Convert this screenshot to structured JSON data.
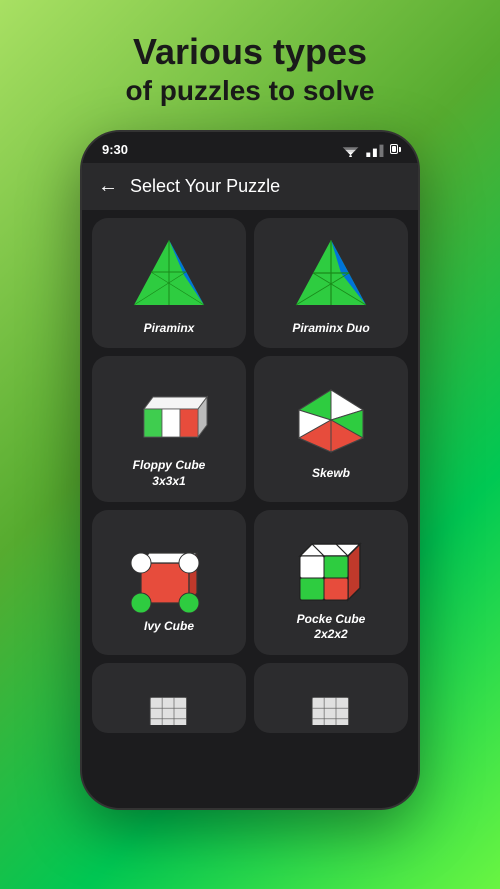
{
  "header": {
    "title": "Various types",
    "subtitle": "of puzzles to solve"
  },
  "status_bar": {
    "time": "9:30"
  },
  "nav": {
    "title": "Select Your Puzzle",
    "back_label": "←"
  },
  "puzzles": [
    {
      "id": "piraminx",
      "label": "Piraminx",
      "sublabel": ""
    },
    {
      "id": "piraminx-duo",
      "label": "Piraminx Duo",
      "sublabel": ""
    },
    {
      "id": "floppy-cube",
      "label": "Floppy Cube",
      "sublabel": "3x3x1"
    },
    {
      "id": "skewb",
      "label": "Skewb",
      "sublabel": ""
    },
    {
      "id": "ivy-cube",
      "label": "Ivy Cube",
      "sublabel": ""
    },
    {
      "id": "pocke-cube",
      "label": "Pocke Cube",
      "sublabel": "2x2x2"
    },
    {
      "id": "cube-a",
      "label": "",
      "sublabel": ""
    },
    {
      "id": "cube-b",
      "label": "",
      "sublabel": ""
    }
  ],
  "colors": {
    "background_gradient_start": "#a8e063",
    "background_gradient_end": "#56ab2f",
    "phone_bg": "#1c1c1e",
    "card_bg": "#2c2c2e",
    "text_primary": "#ffffff",
    "header_text": "#1a1a1a"
  }
}
